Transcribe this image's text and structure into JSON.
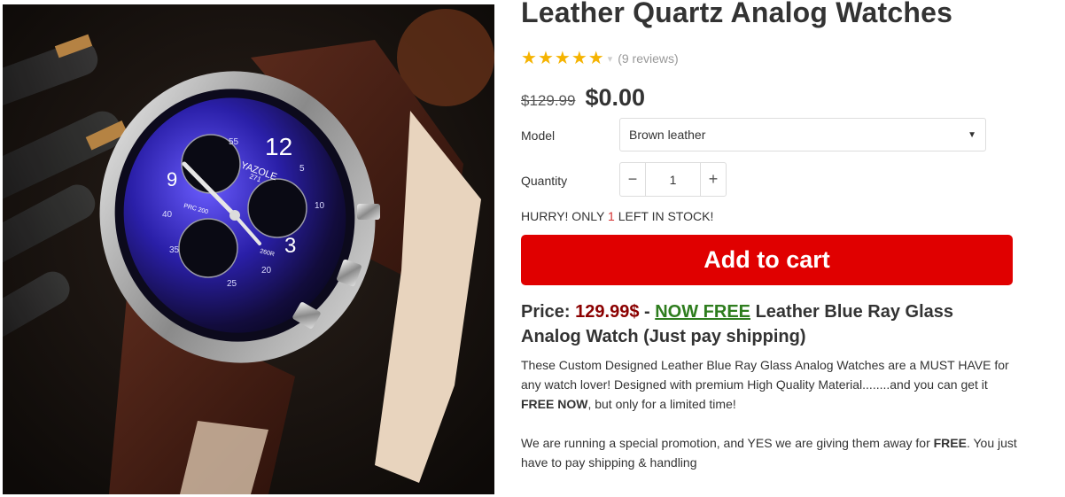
{
  "product": {
    "title": "Leather Quartz Analog Watches",
    "rating": 5,
    "reviews_text": "(9 reviews)",
    "old_price": "$129.99",
    "new_price": "$0.00"
  },
  "options": {
    "model_label": "Model",
    "model_value": "Brown leather",
    "quantity_label": "Quantity",
    "quantity_value": "1",
    "minus": "−",
    "plus": "+"
  },
  "stock": {
    "prefix": "HURRY! ONLY ",
    "count": "1",
    "suffix": " LEFT IN STOCK!"
  },
  "cart": {
    "label": "Add to cart"
  },
  "headline": {
    "price_label": "Price: ",
    "price_value": "129.99$",
    "dash": " - ",
    "free_label": "NOW FREE",
    "rest": " Leather Blue Ray Glass Analog Watch (Just pay shipping)"
  },
  "description": {
    "p1_text": "These Custom Designed Leather Blue Ray Glass Analog Watches are a MUST HAVE for any watch lover! Designed with premium High Quality Material........and you can get it ",
    "p1_bold": "FREE NOW",
    "p1_end": ", but only for a limited time!",
    "p2_text": "We are running a special promotion, and YES we are giving them away for ",
    "p2_bold": "FREE",
    "p2_end": ". You just have to pay shipping & handling"
  },
  "photo": {
    "dial_brand": "YAZOLE",
    "dial_model": "271",
    "dial_numbers": [
      "12",
      "9",
      "3",
      "55",
      "5",
      "10",
      "40",
      "35",
      "25",
      "20"
    ],
    "sub_label_left": "PRC 200",
    "sub_label_right": "260R"
  },
  "colors": {
    "cart_button": "#e00000",
    "star": "#f5b301",
    "free_green": "#2e7d1e",
    "price_red": "#8b0000"
  }
}
